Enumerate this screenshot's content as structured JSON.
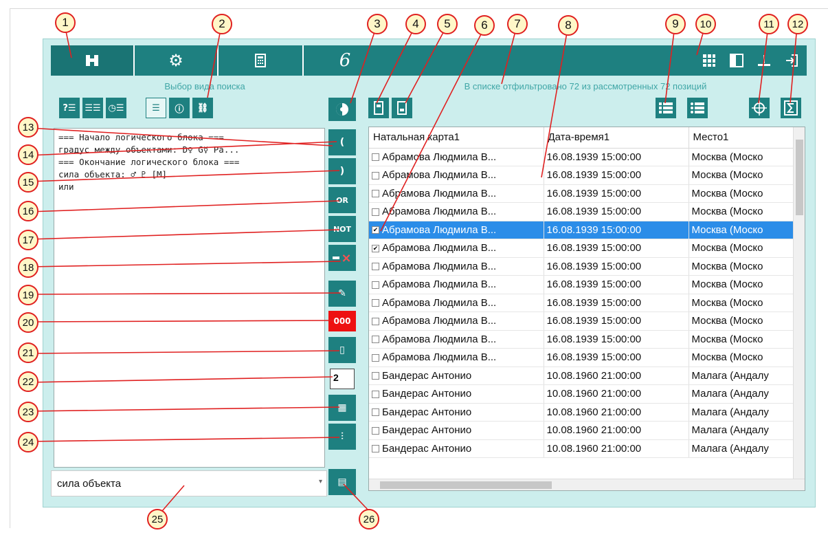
{
  "topbar": {
    "tabs": [
      {
        "name": "binoculars",
        "icon": "binoculars-icon",
        "glyph": "⛓"
      },
      {
        "name": "settings",
        "icon": "gear-icon",
        "glyph": "⚙"
      },
      {
        "name": "calculator",
        "icon": "calculator-icon",
        "glyph": "▦"
      },
      {
        "name": "logo",
        "icon": "logo-icon",
        "glyph": "6"
      }
    ],
    "right_buttons": [
      "grid-icon",
      "panel-layout-icon",
      "minimize-icon",
      "exit-icon"
    ]
  },
  "left_panel": {
    "title": "Выбор вида поиска",
    "search_type_buttons": [
      "?☰",
      "☰☰",
      "◷☰",
      "☰",
      "ⓘ",
      "⛓"
    ],
    "editor_lines": [
      "=== Начало логического блока ===",
      "градус между объектами: D♀ G☿ Pa...",
      "=== Окончание логического блока ===",
      "сила объекта: ♂ ♇ [M]",
      "или"
    ],
    "side_buttons": {
      "open_paren": "(",
      "close_paren": ")",
      "or": "OR",
      "not": "NOT",
      "delete": "×",
      "edit": "✎",
      "counter": "000",
      "new": "▯",
      "number_value": "2",
      "grid_edit": "▦",
      "sliders": "⫶",
      "export": "▤"
    },
    "search_combo": {
      "value": "сила объекта"
    }
  },
  "right_panel": {
    "status": "В списке отфильтровано 72 из рассмотренных 72 позиций",
    "columns": [
      "Натальная карта1",
      "Дата-время1",
      "Место1"
    ],
    "rows": [
      {
        "checked": false,
        "selected": false,
        "name": "Абрамова Людмила В...",
        "datetime": "16.08.1939 15:00:00",
        "place": "Москва (Моско"
      },
      {
        "checked": false,
        "selected": false,
        "name": "Абрамова Людмила В...",
        "datetime": "16.08.1939 15:00:00",
        "place": "Москва (Моско"
      },
      {
        "checked": false,
        "selected": false,
        "name": "Абрамова Людмила В...",
        "datetime": "16.08.1939 15:00:00",
        "place": "Москва (Моско"
      },
      {
        "checked": false,
        "selected": false,
        "name": "Абрамова Людмила В...",
        "datetime": "16.08.1939 15:00:00",
        "place": "Москва (Моско"
      },
      {
        "checked": true,
        "selected": true,
        "name": "Абрамова Людмила В...",
        "datetime": "16.08.1939 15:00:00",
        "place": "Москва (Моско"
      },
      {
        "checked": true,
        "selected": false,
        "name": "Абрамова Людмила В...",
        "datetime": "16.08.1939 15:00:00",
        "place": "Москва (Моско"
      },
      {
        "checked": false,
        "selected": false,
        "name": "Абрамова Людмила В...",
        "datetime": "16.08.1939 15:00:00",
        "place": "Москва (Моско"
      },
      {
        "checked": false,
        "selected": false,
        "name": "Абрамова Людмила В...",
        "datetime": "16.08.1939 15:00:00",
        "place": "Москва (Моско"
      },
      {
        "checked": false,
        "selected": false,
        "name": "Абрамова Людмила В...",
        "datetime": "16.08.1939 15:00:00",
        "place": "Москва (Моско"
      },
      {
        "checked": false,
        "selected": false,
        "name": "Абрамова Людмила В...",
        "datetime": "16.08.1939 15:00:00",
        "place": "Москва (Моско"
      },
      {
        "checked": false,
        "selected": false,
        "name": "Абрамова Людмила В...",
        "datetime": "16.08.1939 15:00:00",
        "place": "Москва (Моско"
      },
      {
        "checked": false,
        "selected": false,
        "name": "Абрамова Людмила В...",
        "datetime": "16.08.1939 15:00:00",
        "place": "Москва (Моско"
      },
      {
        "checked": false,
        "selected": false,
        "name": "Бандерас Антонио",
        "datetime": "10.08.1960 21:00:00",
        "place": "Малага (Андалу"
      },
      {
        "checked": false,
        "selected": false,
        "name": "Бандерас Антонио",
        "datetime": "10.08.1960 21:00:00",
        "place": "Малага (Андалу"
      },
      {
        "checked": false,
        "selected": false,
        "name": "Бандерас Антонио",
        "datetime": "10.08.1960 21:00:00",
        "place": "Малага (Андалу"
      },
      {
        "checked": false,
        "selected": false,
        "name": "Бандерас Антонио",
        "datetime": "10.08.1960 21:00:00",
        "place": "Малага (Андалу"
      },
      {
        "checked": false,
        "selected": false,
        "name": "Бандерас Антонио",
        "datetime": "10.08.1960 21:00:00",
        "place": "Малага (Андалу"
      }
    ]
  },
  "callouts": [
    "1",
    "2",
    "3",
    "4",
    "5",
    "6",
    "7",
    "8",
    "9",
    "10",
    "11",
    "12",
    "13",
    "14",
    "15",
    "16",
    "17",
    "18",
    "19",
    "20",
    "21",
    "22",
    "23",
    "24",
    "25",
    "26"
  ],
  "colors": {
    "accent": "#1e8080",
    "panel_bg": "#cceeed",
    "selection": "#2b8de8",
    "callout_border": "#e02020",
    "callout_fill": "#fff7c8"
  }
}
